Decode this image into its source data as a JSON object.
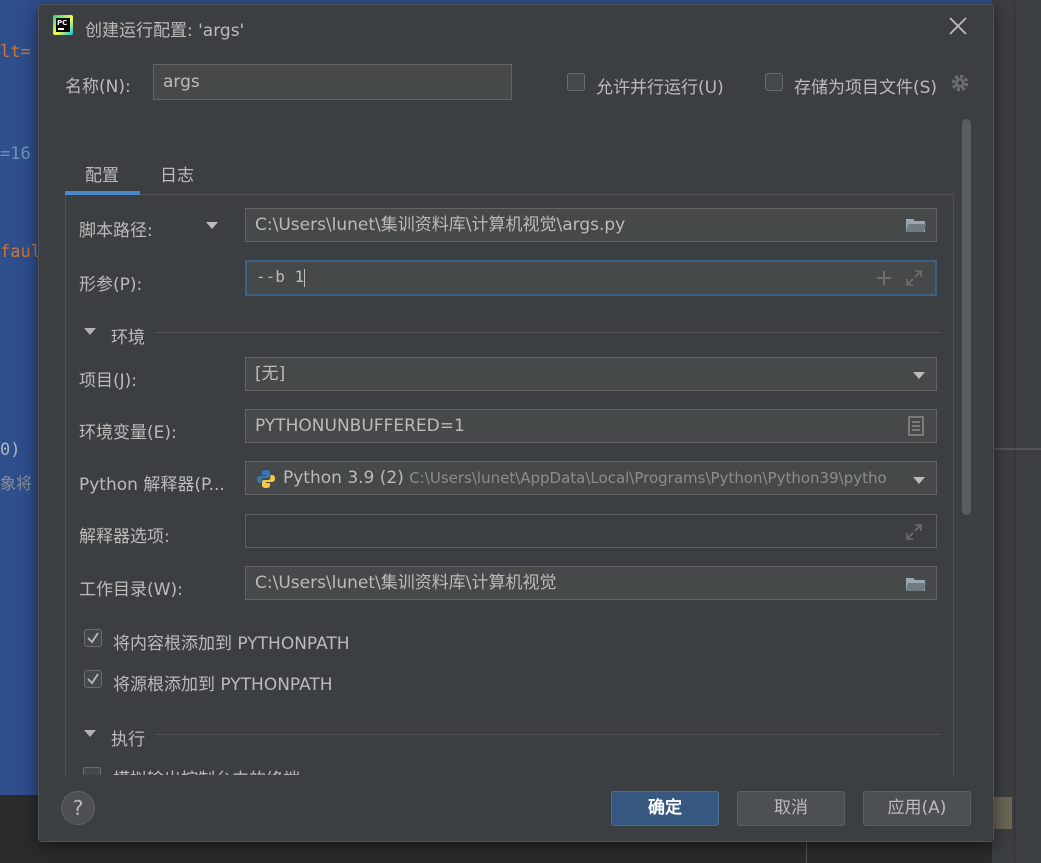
{
  "background": {
    "code_lines": [
      {
        "text": "lt=",
        "color": "orange-white"
      },
      {
        "text": "=16",
        "color": "blue"
      },
      {
        "text": "faul",
        "color": "orange"
      },
      {
        "text": "0)",
        "color": "white"
      },
      {
        "text": "象将",
        "color": "grey"
      }
    ]
  },
  "dialog": {
    "title": "创建运行配置: 'args'",
    "name_label": "名称(N):",
    "name_value": "args",
    "allow_parallel_label": "允许并行运行(U)",
    "allow_parallel_checked": false,
    "store_project_label": "存储为项目文件(S)",
    "store_project_checked": false
  },
  "tabs": [
    {
      "label": "配置",
      "active": true
    },
    {
      "label": "日志",
      "active": false
    }
  ],
  "config": {
    "script_path_label": "脚本路径:",
    "script_path_value": "C:\\Users\\lunet\\集训资料库\\计算机视觉\\args.py",
    "params_label": "形参(P):",
    "params_value": "--b 1",
    "env_section": "环境",
    "project_label": "项目(J):",
    "project_value": "[无]",
    "env_vars_label": "环境变量(E):",
    "env_vars_value": "PYTHONUNBUFFERED=1",
    "interpreter_label": "Python 解释器(P...",
    "interpreter_name": "Python 3.9 (2)",
    "interpreter_path": "C:\\Users\\lunet\\AppData\\Local\\Programs\\Python\\Python39\\pytho",
    "interp_options_label": "解释器选项:",
    "interp_options_value": "",
    "workdir_label": "工作目录(W):",
    "workdir_value": "C:\\Users\\lunet\\集训资料库\\计算机视觉",
    "add_content_roots_label": "将内容根添加到 PYTHONPATH",
    "add_content_roots_checked": true,
    "add_source_roots_label": "将源根添加到 PYTHONPATH",
    "add_source_roots_checked": true,
    "exec_section": "执行",
    "cutoff_row_label": "模拟输出控制台中的终端"
  },
  "buttons": {
    "help": "?",
    "ok": "确定",
    "cancel": "取消",
    "apply": "应用(A)"
  },
  "colors": {
    "dialog_bg": "#3c3f41",
    "field_bg": "#45494a",
    "focus_border": "#3d6185",
    "primary_button": "#365880",
    "tab_underline": "#4a88c7"
  }
}
